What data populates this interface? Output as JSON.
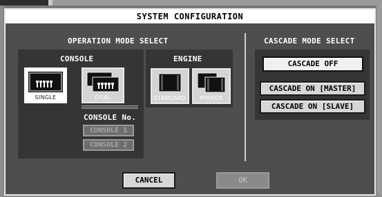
{
  "dialog": {
    "title": "SYSTEM CONFIGURATION"
  },
  "operation_mode": {
    "header": "OPERATION MODE SELECT",
    "console": {
      "header": "CONSOLE",
      "options": [
        {
          "label": "SINGLE",
          "selected": true
        },
        {
          "label": "DUAL",
          "selected": false
        }
      ]
    },
    "engine": {
      "header": "ENGINE",
      "options": [
        {
          "label": "STANDARD",
          "selected": false
        },
        {
          "label": "MIRROR",
          "selected": false
        }
      ]
    },
    "console_no": {
      "header": "CONSOLE No.",
      "options": [
        {
          "label": "CONSOLE 1",
          "enabled": false
        },
        {
          "label": "CONSOLE 2",
          "enabled": false
        }
      ]
    }
  },
  "cascade_mode": {
    "header": "CASCADE MODE SELECT",
    "options": [
      {
        "label": "CASCADE OFF",
        "selected": true
      },
      {
        "label": "CASCADE ON [MASTER]",
        "selected": false
      },
      {
        "label": "CASCADE ON [SLAVE]",
        "selected": false
      }
    ]
  },
  "footer": {
    "cancel_label": "CANCEL",
    "ok_label": "OK",
    "ok_enabled": false
  },
  "colors": {
    "dialog_bg": "#4e4e4e",
    "panel_bg": "#353535",
    "button_face": "#d6d6d6",
    "title_bg": "#ffffff"
  }
}
